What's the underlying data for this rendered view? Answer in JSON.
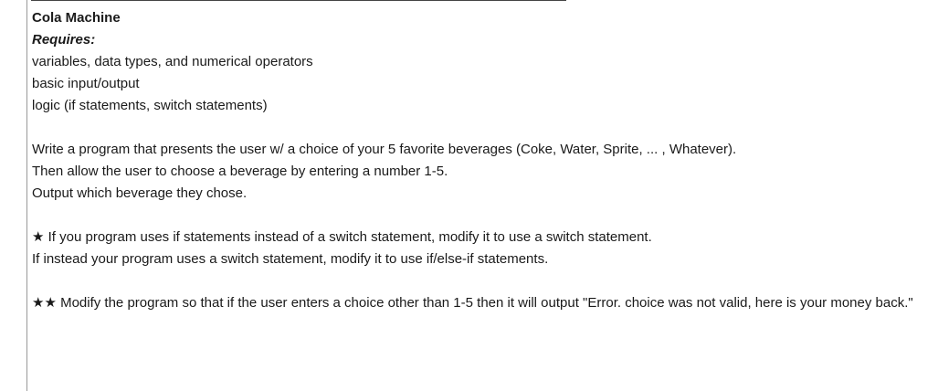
{
  "document": {
    "title": "Cola Machine",
    "requires_label": "Requires:",
    "requirements": [
      "variables, data types, and numerical operators",
      "basic input/output",
      "logic (if statements, switch statements)"
    ],
    "instructions": [
      "Write a program that presents the user w/ a choice of your 5 favorite beverages (Coke, Water, Sprite, ... , Whatever).",
      "Then allow the user to choose a beverage by entering a number 1-5.",
      "Output which beverage they chose."
    ],
    "challenge_one": {
      "stars": "★",
      "line1": " If you program uses if statements instead of a switch statement, modify it to use a switch statement.",
      "line2": "If instead your program uses a switch statement, modify it to use if/else-if statements."
    },
    "challenge_two": {
      "stars": "★★",
      "text": " Modify the program so that if the user enters a choice other than 1-5 then it will output \"Error. choice was not valid, here is your money back.\""
    }
  }
}
